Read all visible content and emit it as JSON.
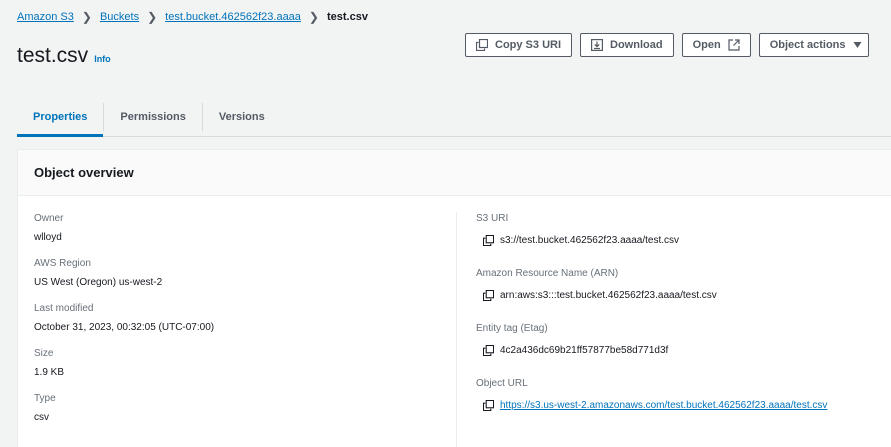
{
  "breadcrumb": {
    "items": [
      "Amazon S3",
      "Buckets",
      "test.bucket.462562f23.aaaa"
    ],
    "current": "test.csv"
  },
  "header": {
    "title": "test.csv",
    "info_label": "Info"
  },
  "actions": {
    "copy_uri": "Copy S3 URI",
    "download": "Download",
    "open": "Open",
    "object_actions": "Object actions"
  },
  "tabs": [
    {
      "label": "Properties",
      "active": true
    },
    {
      "label": "Permissions",
      "active": false
    },
    {
      "label": "Versions",
      "active": false
    }
  ],
  "overview": {
    "title": "Object overview",
    "left": [
      {
        "label": "Owner",
        "value": "wlloyd"
      },
      {
        "label": "AWS Region",
        "value": "US West (Oregon) us-west-2"
      },
      {
        "label": "Last modified",
        "value": "October 31, 2023, 00:32:05 (UTC-07:00)"
      },
      {
        "label": "Size",
        "value": "1.9 KB"
      },
      {
        "label": "Type",
        "value": "csv"
      }
    ],
    "right": [
      {
        "label": "S3 URI",
        "value": "s3://test.bucket.462562f23.aaaa/test.csv"
      },
      {
        "label": "Amazon Resource Name (ARN)",
        "value": "arn:aws:s3:::test.bucket.462562f23.aaaa/test.csv"
      },
      {
        "label": "Entity tag (Etag)",
        "value": "4c2a436dc69b21ff57877be58d771d3f"
      },
      {
        "label": "Object URL",
        "value": "https://s3.us-west-2.amazonaws.com/test.bucket.462562f23.aaaa/test.csv"
      }
    ]
  },
  "colors": {
    "link": "#0073bb",
    "text": "#16191f",
    "muted": "#687078",
    "background": "#f2f3f3"
  },
  "icons": {
    "copy": "copy-icon",
    "download": "download-icon",
    "external": "external-link-icon",
    "dropdown": "caret-down-icon",
    "separator": "chevron-right-icon"
  }
}
